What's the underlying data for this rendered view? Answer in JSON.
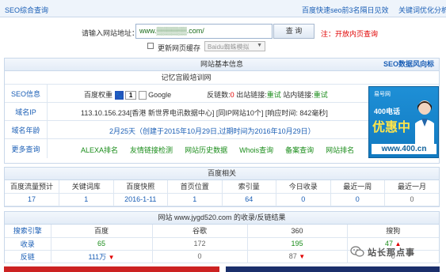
{
  "topbar": {
    "left": "SEO综合查询",
    "right1": "百度快速seo前3名隔日见效",
    "right2": "关键词优化分析"
  },
  "search": {
    "label": "请输入网站地址：",
    "value": "www.▒▒▒▒▒▒.com/",
    "button": "查 询",
    "note": "注：开放内页查询"
  },
  "cache": {
    "checkbox_label": "更新网页缓存",
    "select_value": "Baidu蜘蛛模拟"
  },
  "basic": {
    "header": "网站基本信息",
    "header_link": "SEO数据风向标",
    "site_title": "记忆宫殿培训网",
    "seo": {
      "label": "SEO信息",
      "baidu_weight_label": "百度权重",
      "baidu_weight_value": "1",
      "google_label": "Google",
      "reverse_label": "反链数:",
      "reverse_value": "0",
      "outlinks_label": "出站链接:",
      "outlinks_value": "重试",
      "inlinks_label": "站内链接:",
      "inlinks_value": "重试"
    },
    "ip": {
      "label": "域名IP",
      "text": "113.10.156.234[香港 新世界电讯数据中心] [同IP网站10个] [响应时间: 842毫秒]"
    },
    "age": {
      "label": "域名年龄",
      "text": "2月25天（创建于2015年10月29日,过期时间为2016年10月29日）"
    },
    "more": {
      "label": "更多查询",
      "links": [
        "ALEXA排名",
        "友情链接检测",
        "网站历史数据",
        "Whois查询",
        "备案查询",
        "网站排名"
      ]
    }
  },
  "ad": {
    "logo": "易号网",
    "line1": "400电话",
    "line2": "优惠中",
    "url": "www.400.cn"
  },
  "baidu": {
    "header": "百度相关",
    "headers": [
      "百度流量预计",
      "关键词库",
      "百度快照",
      "首页位置",
      "索引量",
      "今日收录",
      "最近一周",
      "最近一月"
    ],
    "values": [
      "17",
      "1",
      "2016-1-11",
      "1",
      "64",
      "0",
      "0",
      "0"
    ]
  },
  "index": {
    "header": "网站 www.jygd520.com 的收录/反链结果",
    "headers": [
      "搜索引擎",
      "百度",
      "谷歌",
      "360",
      "搜狗"
    ],
    "rows": [
      {
        "label": "收录",
        "baidu": "65",
        "google": "172",
        "s360": "195",
        "sogou": "47"
      },
      {
        "label": "反链",
        "baidu": "111万",
        "google": "0",
        "s360": "87",
        "sogou": "0"
      }
    ]
  },
  "watermark": "站长那点事"
}
